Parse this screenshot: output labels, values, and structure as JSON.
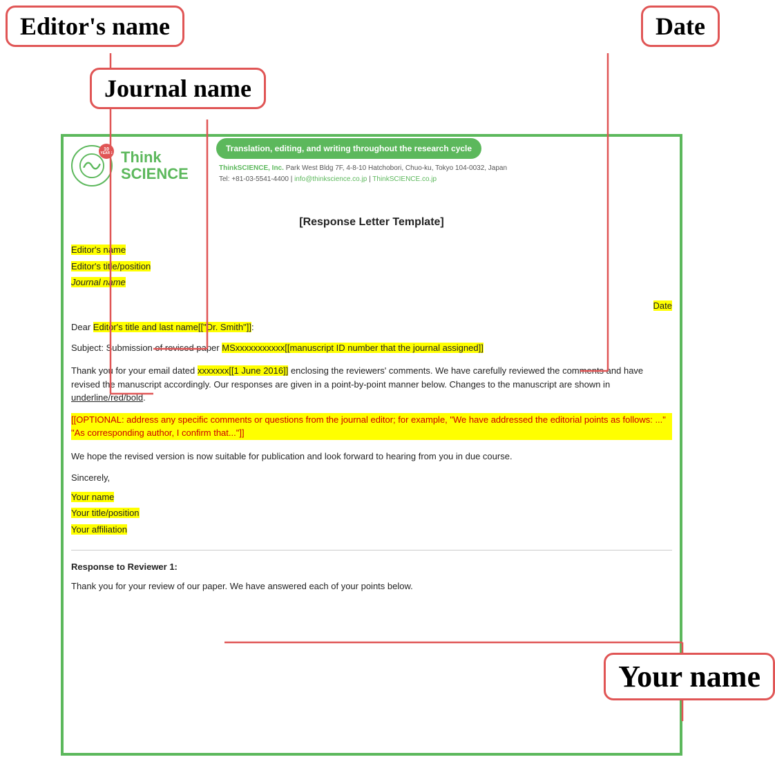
{
  "labels": {
    "editors_name": "Editor's name",
    "date": "Date",
    "journal_name": "Journal name",
    "your_name": "Your name"
  },
  "thinkscience": {
    "badge_num": "10",
    "badge_text": "YEARS",
    "brand_think": "Think",
    "brand_science": "SCIENCE",
    "tagline": "Translation, editing, and writing throughout the research cycle",
    "contact_company": "ThinkSCIENCE, Inc.",
    "contact_address": "Park West Bldg 7F, 4-8-10 Hatchobori, Chuo-ku, Tokyo 104-0032, Japan",
    "contact_tel": "Tel: +81-03-5541-4400",
    "contact_email": "info@thinkscience.co.jp",
    "contact_website": "ThinkSCIENCE.co.jp"
  },
  "letter": {
    "title": "[Response Letter Template]",
    "editor_name_field": "Editor's name",
    "editor_title_field": "Editor's title/position",
    "journal_name_field": "Journal name",
    "date_field": "Date",
    "dear_prefix": "Dear ",
    "dear_field": "Editor's title and last name[[\"Dr. Smith\"]]",
    "dear_suffix": ":",
    "subject_prefix": "Subject:  Submission of revised paper  ",
    "subject_field": "MSxxxxxxxxxxx[[manuscript ID number that the journal assigned]]",
    "body1_prefix": "Thank you for your email dated ",
    "body1_date": "xxxxxxx[[1 June 2016]]",
    "body1_suffix": " enclosing the reviewers' comments. We have carefully reviewed the comments and have revised the manuscript accordingly. Our responses are given in a point-by-point manner below. Changes to the manuscript are shown in ",
    "body1_underline": "underline/red/bold",
    "body1_end": ".",
    "optional": "[[OPTIONAL: address any specific comments or questions from the journal editor; for example, \"We have addressed the editorial points as follows: ...\" \"As corresponding author, I confirm that...\"]]",
    "body2": "We hope the revised version is now suitable for publication and look forward to hearing from you in due course.",
    "sincerely": "Sincerely,",
    "your_name_field": "Your name",
    "your_title_field": "Your title/position",
    "your_affiliation_field": "Your affiliation",
    "response_heading": "Response to Reviewer 1:",
    "response_body": "Thank you for your review of our paper. We have answered each of your points below."
  }
}
